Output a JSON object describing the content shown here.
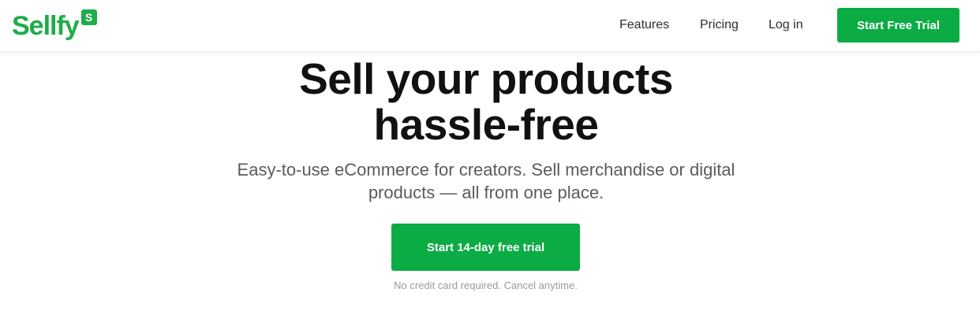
{
  "header": {
    "logo": {
      "text": "Sellfy",
      "badge": "S"
    },
    "nav": {
      "features": "Features",
      "pricing": "Pricing",
      "login": "Log in"
    },
    "cta_label": "Start Free Trial"
  },
  "hero": {
    "title_line1": "Sell your products",
    "title_line2": "hassle-free",
    "subtitle": "Easy-to-use eCommerce for creators. Sell merchandise or digital products — all from one place.",
    "cta_label": "Start 14-day free trial",
    "note": "No credit card required. Cancel anytime."
  },
  "colors": {
    "brand_green": "#0bac43",
    "logo_green": "#1fac4a",
    "title": "#111111",
    "subtitle": "#5b5b5b",
    "note": "#9a9a9a"
  }
}
